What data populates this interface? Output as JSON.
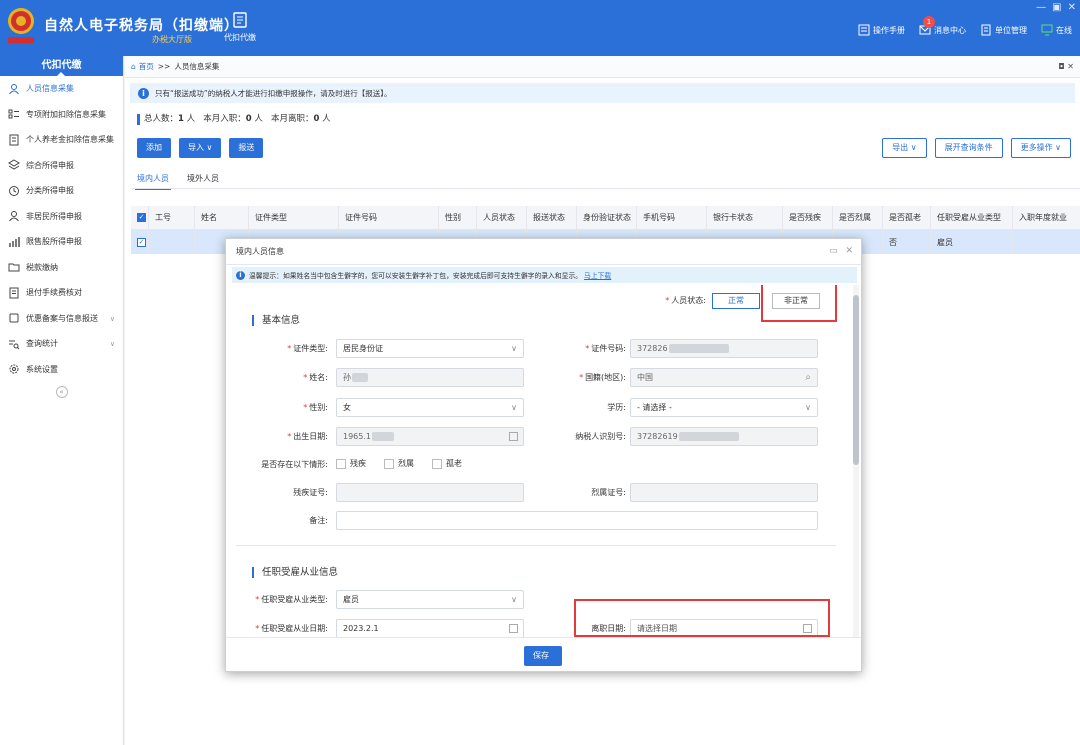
{
  "header": {
    "title": "自然人电子税务局（扣缴端）",
    "subtitle": "办税大厅版",
    "nav_label": "代扣代缴",
    "links": [
      "操作手册",
      "消息中心",
      "单位管理",
      "在线"
    ],
    "message_badge": "1"
  },
  "sidebar": {
    "title": "代扣代缴",
    "items": [
      {
        "label": "人员信息采集",
        "icon": "person-icon"
      },
      {
        "label": "专项附加扣除信息采集",
        "icon": "list-icon"
      },
      {
        "label": "个人养老金扣除信息采集",
        "icon": "document-icon"
      },
      {
        "label": "综合所得申报",
        "icon": "layers-icon"
      },
      {
        "label": "分类所得申报",
        "icon": "clock-icon"
      },
      {
        "label": "非居民所得申报",
        "icon": "person-icon"
      },
      {
        "label": "限售股所得申报",
        "icon": "bar-icon"
      },
      {
        "label": "税款缴纳",
        "icon": "folder-icon"
      },
      {
        "label": "退付手续费核对",
        "icon": "receipt-icon"
      },
      {
        "label": "优惠备案与信息报送",
        "icon": "box-icon"
      },
      {
        "label": "查询统计",
        "icon": "search-list-icon"
      },
      {
        "label": "系统设置",
        "icon": "gear-icon"
      }
    ]
  },
  "breadcrumb": {
    "home": "首页",
    "sep": ">>",
    "current": "人员信息采集"
  },
  "notice": "只有“报送成功”的纳税人才能进行扣缴申报操作，请及时进行【报送】。",
  "stats": {
    "total_label": "总人数：",
    "total": "1",
    "total_unit": "人",
    "joined_label": "本月入职：",
    "joined": "0",
    "joined_unit": "人",
    "left_label": "本月离职：",
    "left": "0",
    "left_unit": "人"
  },
  "toolbar": {
    "add": "添加",
    "import": "导入",
    "submit": "报送",
    "export": "导出",
    "expand_query": "展开查询条件",
    "more": "更多操作"
  },
  "tabs": [
    "境内人员",
    "境外人员"
  ],
  "table": {
    "headers": [
      "工号",
      "姓名",
      "证件类型",
      "证件号码",
      "性别",
      "人员状态",
      "报送状态",
      "身份验证状态",
      "手机号码",
      "银行卡状态",
      "是否残疾",
      "是否烈属",
      "是否孤老",
      "任职受雇从业类型",
      "入职年度就业"
    ],
    "row": {
      "is_orphan_elderly": "否",
      "employment_type": "雇员"
    }
  },
  "modal": {
    "title": "境内人员信息",
    "tip": "温馨提示：如果姓名当中包含生僻字的，您可以安装生僻字补丁包，安装完成后即可支持生僻字的录入和显示。",
    "tip_link": "马上下载",
    "status_label": "人员状态:",
    "status_normal": "正常",
    "status_abnormal": "非正常",
    "section_basic": "基本信息",
    "fields": {
      "id_type_label": "证件类型:",
      "id_type": "居民身份证",
      "id_no_label": "证件号码:",
      "id_no": "372826",
      "name_label": "姓名:",
      "name": "孙",
      "country_label": "国籍(地区):",
      "country": "中国",
      "gender_label": "性别:",
      "gender": "女",
      "education_label": "学历:",
      "education": "- 请选择 -",
      "birth_label": "出生日期:",
      "birth": "1965.1",
      "taxpayer_id_label": "纳税人识别号:",
      "taxpayer_id": "37282619",
      "conditions_label": "是否存在以下情形:",
      "cond_disabled": "残疾",
      "cond_martyr": "烈属",
      "cond_elderly": "孤老",
      "disability_no_label": "残疾证号:",
      "martyr_no_label": "烈属证号:",
      "remark_label": "备注:"
    },
    "section_employment": "任职受雇从业信息",
    "employment": {
      "type_label": "任职受雇从业类型:",
      "type": "雇员",
      "date_label": "任职受雇从业日期:",
      "date": "2023.2.1",
      "leave_label": "离职日期:",
      "leave_placeholder": "请选择日期"
    },
    "save": "保存"
  }
}
